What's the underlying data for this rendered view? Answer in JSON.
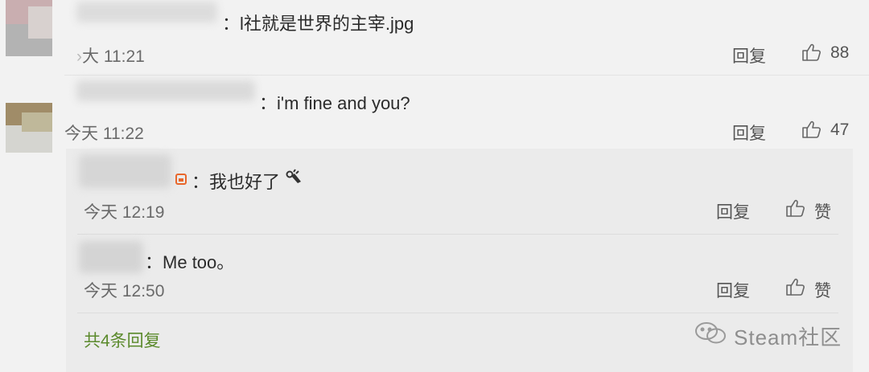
{
  "comments": [
    {
      "text": "l社就是世界的主宰.jpg",
      "time": "今天 11:21",
      "time_visible": "大 11:21",
      "reply_label": "回复",
      "like_count": "88"
    },
    {
      "text": "i'm fine and you?",
      "time": "今天 11:22",
      "reply_label": "回复",
      "like_count": "47",
      "replies": [
        {
          "text": "我也好了",
          "time": "今天 12:19",
          "reply_label": "回复",
          "like_label": "赞"
        },
        {
          "text": "Me too。",
          "time": "今天 12:50",
          "reply_label": "回复",
          "like_label": "赞"
        }
      ],
      "more_replies": "共4条回复"
    }
  ],
  "watermark": "Steam社区",
  "icons": {
    "like": "thumbs-up-icon",
    "ok_hand": "ok-hand-emoji",
    "badge": "user-badge-icon",
    "wechat": "wechat-logo-icon"
  },
  "colors": {
    "background": "#f2f2f2",
    "reply_background": "#ebebeb",
    "more_replies_link": "#5b8a2c",
    "badge": "#e8672c"
  }
}
